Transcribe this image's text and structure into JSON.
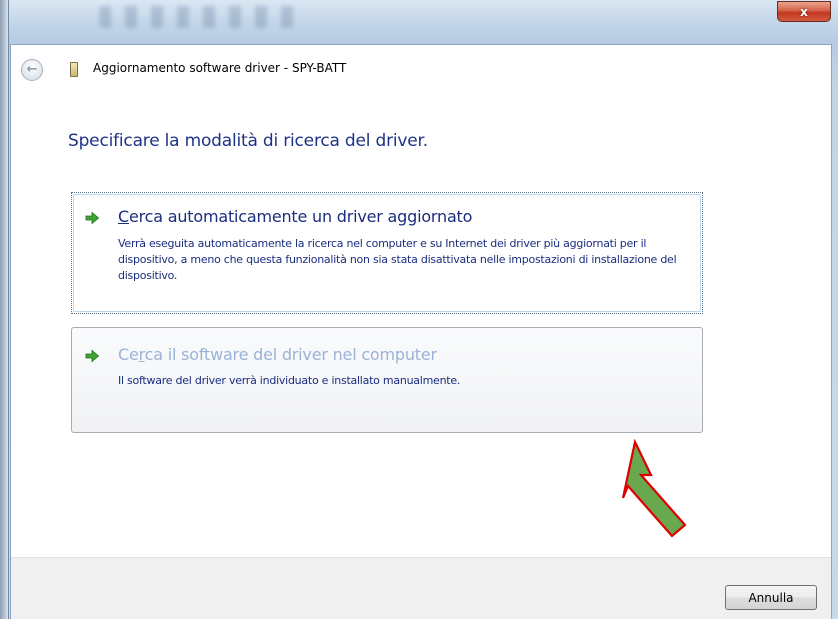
{
  "window": {
    "title": "Aggiornamento software driver - SPY-BATT",
    "close_label": "x"
  },
  "main": {
    "heading": "Specificare la modalità di ricerca del driver.",
    "options": [
      {
        "title_accel": "C",
        "title_rest": "erca automaticamente un driver aggiornato",
        "description": "Verrà eseguita automaticamente la ricerca nel computer e su Internet dei driver più aggiornati per il dispositivo, a meno che questa funzionalità non sia stata disattivata nelle impostazioni di installazione del dispositivo.",
        "icon": "green-arrow-icon"
      },
      {
        "title_pre": "Ce",
        "title_accel": "r",
        "title_rest": "ca il software del driver nel computer",
        "description": "Il software del driver verrà individuato e installato manualmente.",
        "icon": "green-arrow-icon"
      }
    ]
  },
  "annotation": {
    "icon": "green-pointer-arrow",
    "fill": "#6aa84f",
    "outline": "#e00000"
  },
  "footer": {
    "cancel_label": "Annulla"
  },
  "colors": {
    "heading": "#1e3287",
    "link": "#1a2d7f",
    "hover_link": "#9ab2d8",
    "close": "#c2381f"
  }
}
